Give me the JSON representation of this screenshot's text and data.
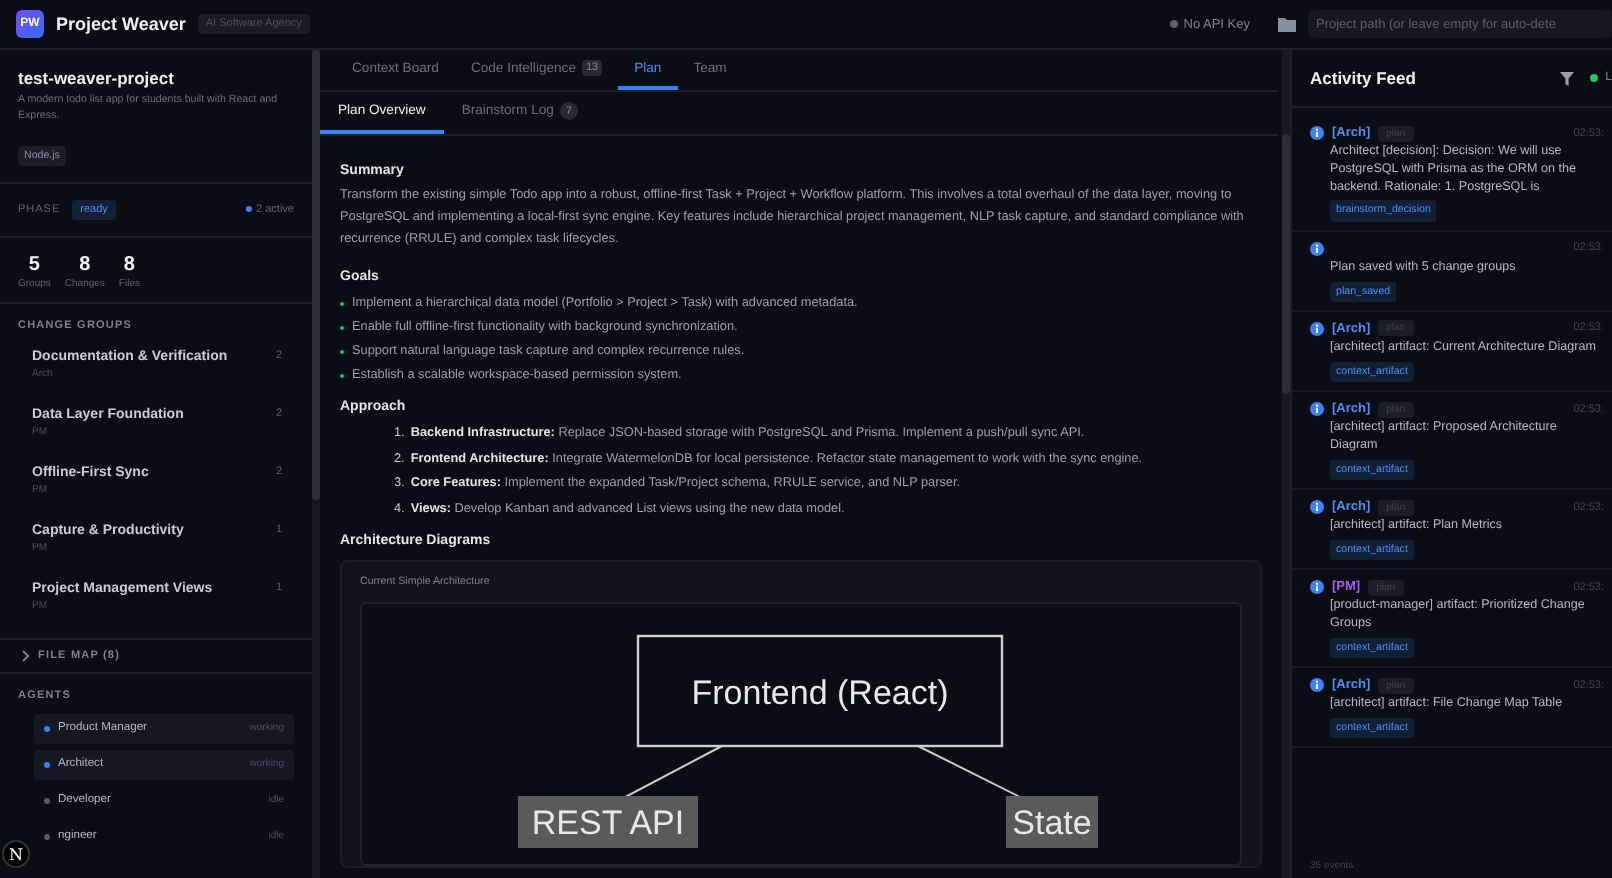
{
  "app": {
    "logo": "PW",
    "title": "Project Weaver",
    "badge": "AI Software Agency"
  },
  "topbar": {
    "api_key_status": "No API Key",
    "path_placeholder": "Project path (or leave empty for auto-dete"
  },
  "project": {
    "name": "test-weaver-project",
    "description": "A modern todo list app for students built with React and Express.",
    "tags": [
      "Node.js"
    ]
  },
  "phase": {
    "label": "PHASE",
    "value": "ready",
    "active": "2 active"
  },
  "stats": [
    {
      "value": "5",
      "label": "Groups"
    },
    {
      "value": "8",
      "label": "Changes"
    },
    {
      "value": "8",
      "label": "Files"
    }
  ],
  "change_groups": {
    "title": "CHANGE GROUPS",
    "items": [
      {
        "name": "Documentation & Verification",
        "owner": "Arch",
        "count": "2"
      },
      {
        "name": "Data Layer Foundation",
        "owner": "PM",
        "count": "2"
      },
      {
        "name": "Offline-First Sync",
        "owner": "PM",
        "count": "2"
      },
      {
        "name": "Capture & Productivity",
        "owner": "PM",
        "count": "1"
      },
      {
        "name": "Project Management Views",
        "owner": "PM",
        "count": "1"
      }
    ]
  },
  "file_map": {
    "label": "FILE MAP (8)",
    "expanded": false
  },
  "agents": {
    "title": "AGENTS",
    "items": [
      {
        "name": "Product Manager",
        "status": "working",
        "working": true
      },
      {
        "name": "Architect",
        "status": "working",
        "working": true
      },
      {
        "name": "Developer",
        "status": "idle",
        "working": false
      },
      {
        "name": "ngineer",
        "status": "idle",
        "working": false
      }
    ]
  },
  "dev_badge": "N",
  "tabs": [
    {
      "label": "Context Board",
      "selected": false
    },
    {
      "label": "Code Intelligence",
      "count": "13",
      "selected": false
    },
    {
      "label": "Plan",
      "selected": true
    },
    {
      "label": "Team",
      "selected": false
    }
  ],
  "subtabs": [
    {
      "label": "Plan Overview",
      "selected": true
    },
    {
      "label": "Brainstorm Log",
      "count": "7",
      "selected": false
    }
  ],
  "plan": {
    "summary": {
      "title": "Summary",
      "text": "Transform the existing simple Todo app into a robust, offline-first Task + Project + Workflow platform. This involves a total overhaul of the data layer, moving to PostgreSQL and implementing a local-first sync engine. Key features include hierarchical project management, NLP task capture, and standard compliance with recurrence (RRULE) and complex task lifecycles."
    },
    "goals": {
      "title": "Goals",
      "items": [
        "Implement a hierarchical data model (Portfolio > Project > Task) with advanced metadata.",
        "Enable full offline-first functionality with background synchronization.",
        "Support natural language task capture and complex recurrence rules.",
        "Establish a scalable workspace-based permission system."
      ]
    },
    "approach": {
      "title": "Approach",
      "items": [
        {
          "number": "1.",
          "text": "**Backend Infrastructure:** Replace JSON-based storage with PostgreSQL and Prisma. Implement a push/pull sync API."
        },
        {
          "number": "2.",
          "text": "**Frontend Architecture:** Integrate WatermelonDB for local persistence. Refactor state management to work with the sync engine."
        },
        {
          "number": "3.",
          "text": "**Core Features:** Implement the expanded Task/Project schema, RRULE service, and NLP parser."
        },
        {
          "number": "4.",
          "text": "**Views:** Develop Kanban and advanced List views using the new data model."
        }
      ]
    },
    "diagrams": {
      "title": "Architecture Diagrams",
      "cards": [
        {
          "title": "Current Simple Architecture",
          "nodes": [
            {
              "label": "Frontend (React)",
              "kind": "box"
            },
            {
              "label": "REST API",
              "kind": "label"
            },
            {
              "label": "State",
              "kind": "label"
            }
          ]
        }
      ]
    }
  },
  "feed": {
    "title": "Activity Feed",
    "live": "L",
    "footer": "35 events",
    "events": [
      {
        "agent": "[Arch]",
        "color": "#4d8ef7",
        "phase": "plan",
        "time": "02:53:",
        "message": "Architect [decision]: Decision: We will use PostgreSQL with Prisma as the ORM on the backend. Rationale: 1. PostgreSQL is",
        "tag": "brainstorm_decision"
      },
      {
        "time": "02:53:",
        "message": "Plan saved with 5 change groups",
        "tag": "plan_saved"
      },
      {
        "agent": "[Arch]",
        "color": "#4d8ef7",
        "phase": "plan",
        "time": "02:53:",
        "message": "[architect] artifact: Current Architecture Diagram",
        "tag": "context_artifact"
      },
      {
        "agent": "[Arch]",
        "color": "#4d8ef7",
        "phase": "plan",
        "time": "02:53:",
        "message": "[architect] artifact: Proposed Architecture Diagram",
        "tag": "context_artifact"
      },
      {
        "agent": "[Arch]",
        "color": "#4d8ef7",
        "phase": "plan",
        "time": "02:53:",
        "message": "[architect] artifact: Plan Metrics",
        "tag": "context_artifact"
      },
      {
        "agent": "[PM]",
        "color": "#a55ef0",
        "phase": "plan",
        "time": "02:53:",
        "message": "[product-manager] artifact: Prioritized Change Groups",
        "tag": "context_artifact"
      },
      {
        "agent": "[Arch]",
        "color": "#4d8ef7",
        "phase": "plan",
        "time": "02:53:",
        "message": "[architect] artifact: File Change Map Table",
        "tag": "context_artifact"
      }
    ]
  }
}
